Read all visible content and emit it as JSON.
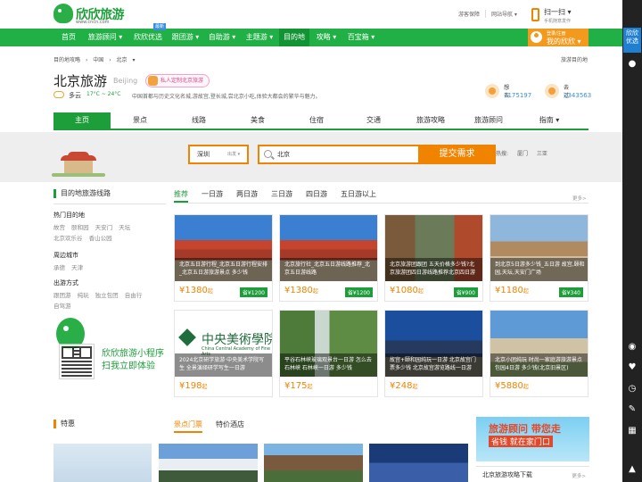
{
  "header": {
    "logo_text": "欣欣旅游",
    "logo_url": "www.cncn.com",
    "top_links": [
      "游客保障",
      "网站导航 ▾"
    ],
    "scan_title": "扫一扫 ▾",
    "scan_sub": "手机随意发作"
  },
  "nav": {
    "items": [
      "首页",
      "旅游顾问 ▾",
      "欣欣优选",
      "跟团游 ▾",
      "自助游 ▾",
      "主题游 ▾",
      "目的地",
      "攻略 ▾",
      "百宝箱 ▾"
    ],
    "hot_badge": "最新",
    "my_small": "登录/注册",
    "my_label": "我的欣欣 ▾"
  },
  "breadcrumb": {
    "items": [
      "目的地攻略",
      "›",
      "中国",
      "›",
      "北京",
      "▾"
    ],
    "right": "旅游目的地"
  },
  "city": {
    "name": "北京旅游",
    "name_en": "Beijing",
    "custom_tag": "私人定制北京旅游",
    "weather": "多云",
    "temp": "17°C ~ 24°C",
    "intro": "中国首都与历史文化名城,游故宫,登长城,尝北京小吃,体验大都会的繁华与魅力。",
    "stat_want_label": "想去",
    "stat_want_num": "1175197",
    "stat_been_label": "去过",
    "stat_been_num": "2343563"
  },
  "subnav": [
    "主页",
    "景点",
    "线路",
    "美食",
    "住宿",
    "交通",
    "旅游攻略",
    "旅游顾问",
    "指南 ▾"
  ],
  "search": {
    "from_city": "深圳",
    "from_label": "出发 ▾",
    "to_value": "北京",
    "submit_label": "提交需求",
    "hot_label": "热搜:",
    "hot_items": [
      "厦门",
      "三亚"
    ]
  },
  "left": {
    "section_title": "目的地旅游线路",
    "hot_title": "热门目的地",
    "hot_links": [
      "故宫",
      "颐和园",
      "天安门",
      "天坛",
      "北京欢乐谷",
      "香山公园"
    ],
    "nearby_title": "周边城市",
    "nearby_links": [
      "承德",
      "天津"
    ],
    "mode_title": "出游方式",
    "mode_links": [
      "跟团游",
      "纯玩",
      "独立包团",
      "自由行",
      "自驾游"
    ],
    "mini_line1": "欣欣旅游小程序",
    "mini_line2": "扫我立即体验"
  },
  "tabs": {
    "items": [
      "推荐",
      "一日游",
      "两日游",
      "三日游",
      "四日游",
      "五日游以上"
    ],
    "more": "更多>"
  },
  "cards": [
    {
      "caption": "北京五日游行程_北京五日游行程安排_北京五日游旅游景点 多少钱",
      "price": "¥1380",
      "unit": "起",
      "save": "省¥1200"
    },
    {
      "caption": "北京旅行社_北京五日游线路推荐_北京五日游线路",
      "price": "¥1380",
      "unit": "起",
      "save": "省¥1200"
    },
    {
      "caption": "北京旅游团跟团 五天价格多少钱?北京旅游团四日游线路推荐北京四日游",
      "price": "¥1080",
      "unit": "起",
      "save": "省¥900"
    },
    {
      "caption": "到北京5日游多少钱_五日游 故宫,颐和园,天坛,天安门广场",
      "price": "¥1180",
      "unit": "起",
      "save": "省¥340"
    },
    {
      "caption": "2024北京研学旅游·中央美术学院写生 全景演绎研学写生一日游",
      "price": "¥198",
      "unit": "起",
      "save": ""
    },
    {
      "caption": "平谷石林峡玻璃观景台一日游 怎么去 石林峡 石林峡一日游 多少钱",
      "price": "¥175",
      "unit": "起",
      "save": ""
    },
    {
      "caption": "故宫+颐和园纯玩一日游 北京故宫门票多少钱 北京故宫游览路线一日游",
      "price": "¥248",
      "unit": "起",
      "save": ""
    },
    {
      "caption": "北京小团纯玩 时尚一家庭游旅游景点 包园4日游 多少钱(北京旧景区)",
      "price": "¥5880",
      "unit": "起",
      "save": ""
    }
  ],
  "art_card": {
    "cn": "中央美術學院",
    "en": "China Central Academy of Fine Arts"
  },
  "bottom": {
    "title": "特惠",
    "tab1": "景点门票",
    "tab2": "特价酒店",
    "ad_line1": "旅游顾问 带您走",
    "ad_line2": "省钱 就在家门口",
    "download_title": "北京旅游攻略下载",
    "download_more": "更多>"
  },
  "sidebar": {
    "youxuan": "欣欣优选",
    "icons": [
      "wechat-icon",
      "user-icon",
      "heart-icon",
      "clock-icon",
      "edit-icon",
      "qrcode-icon",
      "top-icon"
    ]
  },
  "colors": {
    "brand_green": "#1e9e3b",
    "accent_orange": "#f08300",
    "link_blue": "#3a8edb"
  }
}
